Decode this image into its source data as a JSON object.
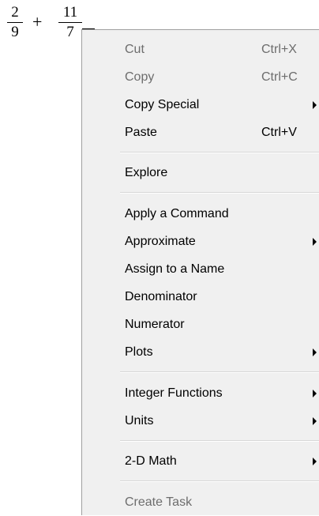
{
  "expression": {
    "fraction1": {
      "numerator": "2",
      "denominator": "9"
    },
    "operator": "+",
    "fraction2": {
      "numerator": "11",
      "denominator": "7"
    }
  },
  "menu": {
    "items": [
      {
        "label": "Cut",
        "shortcut": "Ctrl+X",
        "disabled": true,
        "submenu": false
      },
      {
        "label": "Copy",
        "shortcut": "Ctrl+C",
        "disabled": true,
        "submenu": false
      },
      {
        "label": "Copy Special",
        "shortcut": "",
        "disabled": false,
        "submenu": true
      },
      {
        "label": "Paste",
        "shortcut": "Ctrl+V",
        "disabled": false,
        "submenu": false
      },
      {
        "label": "Explore",
        "shortcut": "",
        "disabled": false,
        "submenu": false
      },
      {
        "label": "Apply a Command",
        "shortcut": "",
        "disabled": false,
        "submenu": false
      },
      {
        "label": "Approximate",
        "shortcut": "",
        "disabled": false,
        "submenu": true
      },
      {
        "label": "Assign to a Name",
        "shortcut": "",
        "disabled": false,
        "submenu": false
      },
      {
        "label": "Denominator",
        "shortcut": "",
        "disabled": false,
        "submenu": false
      },
      {
        "label": "Numerator",
        "shortcut": "",
        "disabled": false,
        "submenu": false
      },
      {
        "label": "Plots",
        "shortcut": "",
        "disabled": false,
        "submenu": true
      },
      {
        "label": "Integer Functions",
        "shortcut": "",
        "disabled": false,
        "submenu": true
      },
      {
        "label": "Units",
        "shortcut": "",
        "disabled": false,
        "submenu": true
      },
      {
        "label": "2-D Math",
        "shortcut": "",
        "disabled": false,
        "submenu": true
      },
      {
        "label": "Create Task",
        "shortcut": "",
        "disabled": true,
        "submenu": false
      }
    ]
  }
}
